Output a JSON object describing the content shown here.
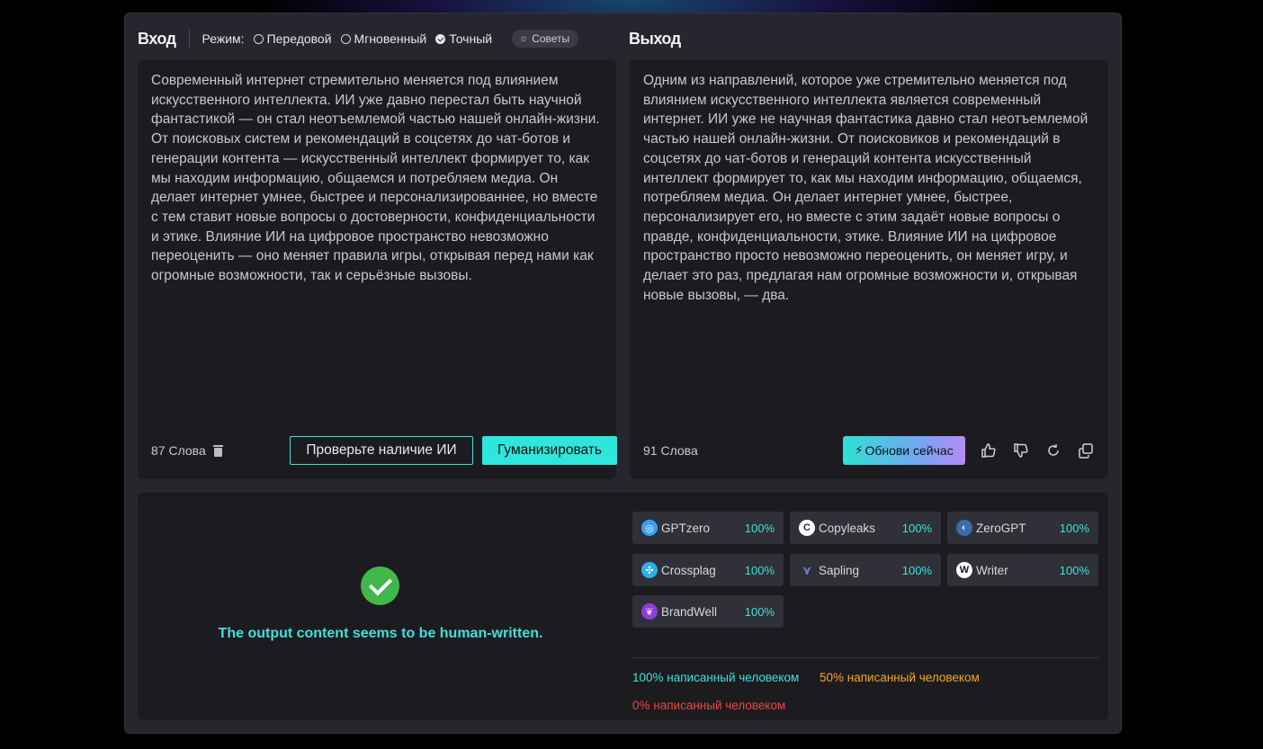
{
  "colors": {
    "accent": "#2ee6dc",
    "human": "#3fe0d8",
    "mixed": "#f5a623",
    "ai": "#ef4444",
    "success": "#41b84a"
  },
  "input": {
    "title": "Вход",
    "mode_label": "Режим:",
    "modes": [
      {
        "label": "Передовой",
        "checked": false
      },
      {
        "label": "Мгновенный",
        "checked": false
      },
      {
        "label": "Точный",
        "checked": true
      }
    ],
    "tips_label": "Советы",
    "text": "Современный интернет стремительно меняется под влиянием искусственного интеллекта. ИИ уже давно перестал быть научной фантастикой — он стал неотъемлемой частью нашей онлайн-жизни. От поисковых систем и рекомендаций в соцсетях до чат-ботов и генерации контента — искусственный интеллект формирует то, как мы находим информацию, общаемся и потребляем медиа. Он делает интернет умнее, быстрее и персонализированнее, но вместе с тем ставит новые вопросы о достоверности, конфиденциальности и этике. Влияние ИИ на цифровое пространство невозможно переоценить — оно меняет правила игры, открывая перед нами как огромные возможности, так и серьёзные вызовы.",
    "word_count": "87 Слова",
    "check_button": "Проверьте наличие ИИ",
    "humanize_button": "Гуманизировать"
  },
  "output": {
    "title": "Выход",
    "text": "Одним из направлений, которое уже стремительно меняется под влиянием искусственного интеллекта является современный интернет. ИИ уже не научная фантастика давно стал неотъемлемой частью нашей онлайн-жизни. От поисковиков и рекомендаций в соцсетях до чат-ботов и генераций контента искусственный интеллект формирует то, как мы находим информацию, общаемся, потребляем медиа. Он делает интернет умнее, быстрее, персонализирует его, но вместе с этим задаёт новые вопросы о правде, конфиденциальности, этике. Влияние ИИ на цифровое пространство просто невозможно переоценить, он меняет игру, и делает это раз, предлагая нам огромные возможности и, открывая новые вызовы, — два.",
    "word_count": "91 Слова",
    "update_button": "Обнови сейчас",
    "action_icons": [
      "thumbs-up-icon",
      "thumbs-down-icon",
      "regenerate-icon",
      "copy-icon"
    ]
  },
  "result": {
    "verdict": "The output content seems to be human-written.",
    "detectors": [
      {
        "name": "GPTzero",
        "score": "100%",
        "icon": "gptzero-logo-icon"
      },
      {
        "name": "Copyleaks",
        "score": "100%",
        "icon": "copyleaks-logo-icon"
      },
      {
        "name": "ZeroGPT",
        "score": "100%",
        "icon": "zerogpt-logo-icon"
      },
      {
        "name": "Crossplag",
        "score": "100%",
        "icon": "crossplag-logo-icon"
      },
      {
        "name": "Sapling",
        "score": "100%",
        "icon": "sapling-logo-icon"
      },
      {
        "name": "Writer",
        "score": "100%",
        "icon": "writer-logo-icon"
      },
      {
        "name": "BrandWell",
        "score": "100%",
        "icon": "brandwell-logo-icon"
      }
    ],
    "legend": {
      "human": "100% написанный человеком",
      "mixed": "50% написанный человеком",
      "ai": "0% написанный человеком"
    }
  }
}
